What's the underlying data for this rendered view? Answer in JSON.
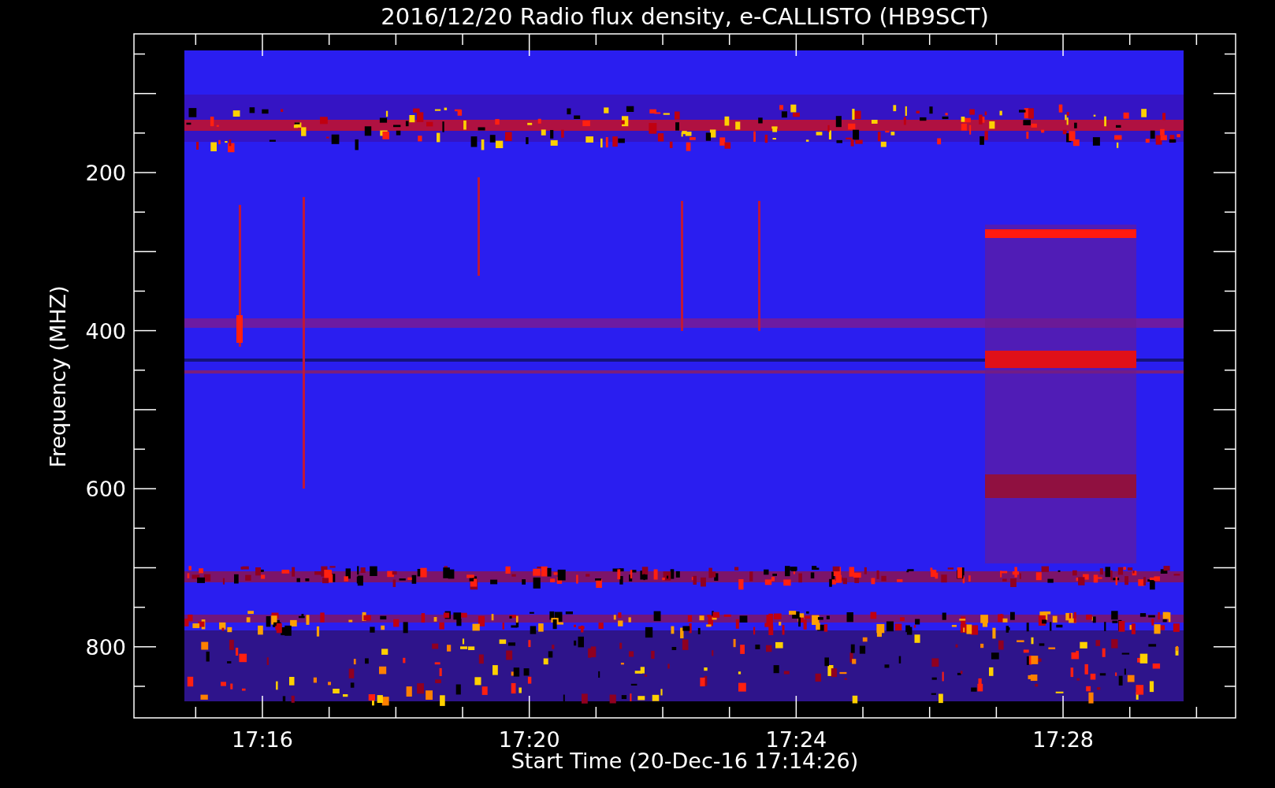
{
  "chart": {
    "title": "2016/12/20  Radio flux density, e-CALLISTO (HB9SCT)",
    "ylabel": "Frequency (MHZ)",
    "xlabel": "Start Time (20-Dec-16 17:14:26)",
    "yticks": [
      "200",
      "400",
      "600",
      "800"
    ],
    "xticks": [
      "17:16",
      "17:20",
      "17:24",
      "17:28"
    ]
  }
}
